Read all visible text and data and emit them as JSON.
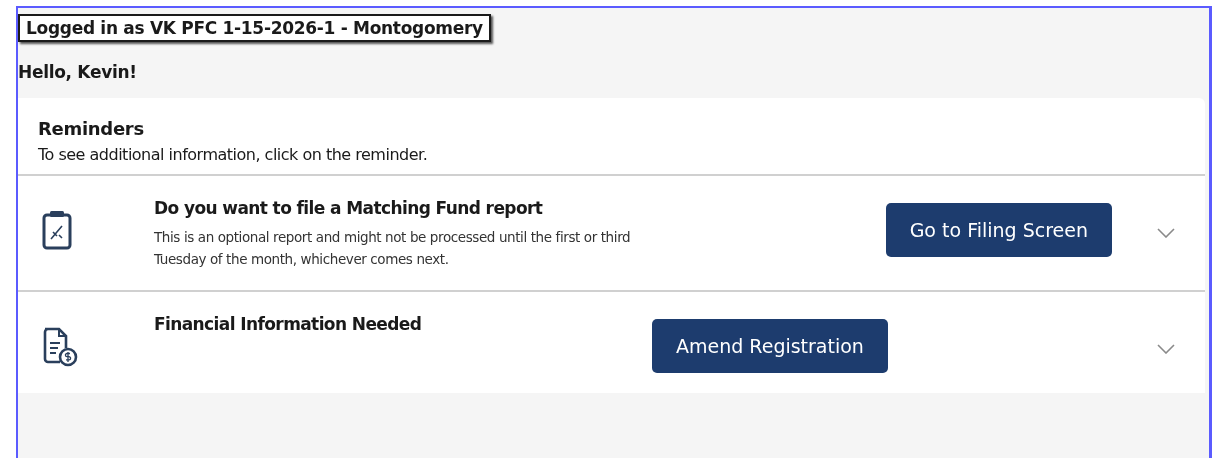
{
  "login_banner": "Logged in as VK PFC 1-15-2026-1 - Montogomery",
  "greeting": "Hello, Kevin!",
  "reminders": {
    "title": "Reminders",
    "subtitle": "To see additional information, click on the reminder.",
    "items": [
      {
        "kind": "clipboard",
        "title": "Do you want to file a Matching Fund report",
        "description": "This is an optional report and might not be processed until the first or third Tuesday of the month, whichever comes next.",
        "button": "Go to Filing Screen",
        "expanded": false
      },
      {
        "kind": "invoice",
        "title": "Financial Information Needed",
        "button": "Amend Registration",
        "expanded": false
      }
    ]
  }
}
